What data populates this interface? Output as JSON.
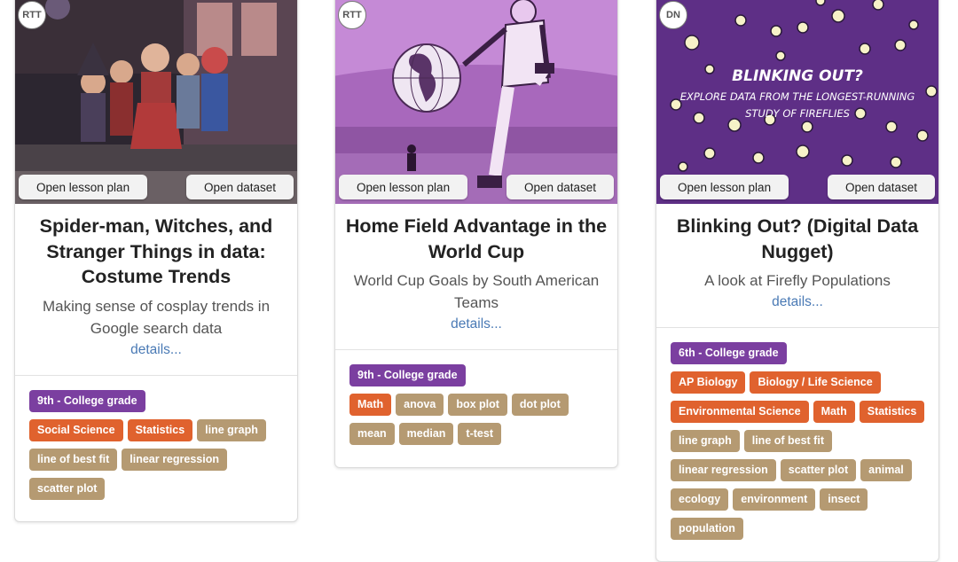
{
  "cards": [
    {
      "badge": "RTT",
      "lesson_label": "Open lesson plan",
      "dataset_label": "Open dataset",
      "title": "Spider-man, Witches, and Stranger Things in data: Costume Trends",
      "subtitle": "Making sense of cosplay trends in Google search data",
      "details": "details...",
      "grade": "9th - College grade",
      "subjects": [
        "Social Science",
        "Statistics"
      ],
      "topics": [
        "line graph",
        "line of best fit",
        "linear regression",
        "scatter plot"
      ]
    },
    {
      "badge": "RTT",
      "lesson_label": "Open lesson plan",
      "dataset_label": "Open dataset",
      "title": "Home Field Advantage in the World Cup",
      "subtitle": "World Cup Goals by South American Teams",
      "details": "details...",
      "grade": "9th - College grade",
      "subjects": [
        "Math"
      ],
      "topics": [
        "anova",
        "box plot",
        "dot plot",
        "mean",
        "median",
        "t-test"
      ]
    },
    {
      "badge": "DN",
      "lesson_label": "Open lesson plan",
      "dataset_label": "Open dataset",
      "image_title": "BLINKING OUT?",
      "image_subtitle_1": "EXPLORE DATA FROM THE LONGEST-RUNNING",
      "image_subtitle_2": "STUDY OF FIREFLIES",
      "title": "Blinking Out? (Digital Data Nugget)",
      "subtitle": "A look at Firefly Populations",
      "details": "details...",
      "grade": "6th - College grade",
      "subjects": [
        "AP Biology",
        "Biology / Life Science",
        "Environmental Science",
        "Math",
        "Statistics"
      ],
      "topics": [
        "line graph",
        "line of best fit",
        "linear regression",
        "scatter plot",
        "animal",
        "ecology",
        "environment",
        "insect",
        "population"
      ]
    }
  ],
  "colors": {
    "grade_tag": "#7b3fa0",
    "subject_tag": "#e0622e",
    "topic_tag": "#b59a72",
    "link": "#4a7ab5"
  }
}
